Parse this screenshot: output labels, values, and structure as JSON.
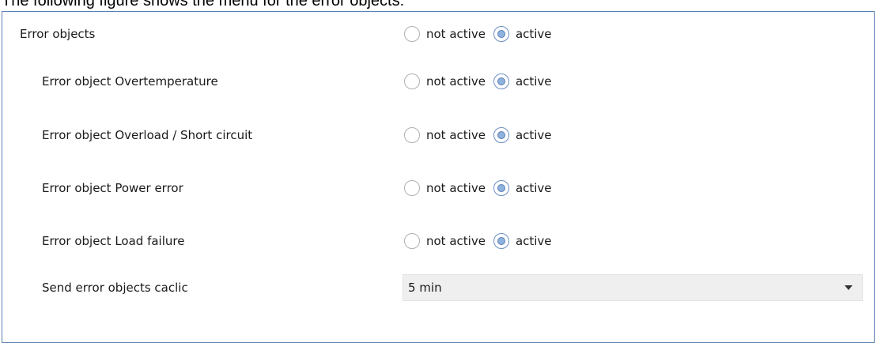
{
  "caption": "The following figure shows the menu for the error objects:",
  "options": {
    "not_active": "not active",
    "active": "active"
  },
  "rows": [
    {
      "label": "Error objects",
      "selected": "active"
    },
    {
      "label": "Error object Overtemperature",
      "selected": "active"
    },
    {
      "label": "Error object Overload / Short circuit",
      "selected": "active"
    },
    {
      "label": "Error object Power error",
      "selected": "active"
    },
    {
      "label": "Error object Load failure",
      "selected": "active"
    }
  ],
  "send_cyclic": {
    "label": "Send error objects caclic",
    "value": "5 min"
  },
  "colors": {
    "panel_border": "#5a7fb0",
    "radio_selected_fill": "#8fb1de",
    "dropdown_bg": "#efefef"
  },
  "icons": {
    "dropdown": "chevron-down-icon"
  }
}
